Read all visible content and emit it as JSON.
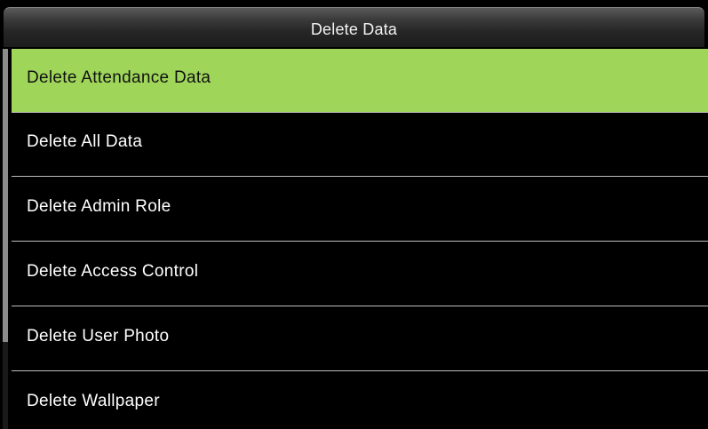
{
  "header": {
    "title": "Delete Data"
  },
  "menu": {
    "items": [
      {
        "label": "Delete Attendance Data"
      },
      {
        "label": "Delete All Data"
      },
      {
        "label": "Delete Admin Role"
      },
      {
        "label": "Delete Access Control"
      },
      {
        "label": "Delete User Photo"
      },
      {
        "label": "Delete Wallpaper"
      }
    ],
    "selected_index": 0
  },
  "scrollbar": {
    "visible_fraction": 0.77,
    "position_fraction": 0
  },
  "colors": {
    "background": "#000000",
    "highlight": "#9fd65a",
    "text": "#ffffff",
    "divider": "#bdbdbd"
  }
}
